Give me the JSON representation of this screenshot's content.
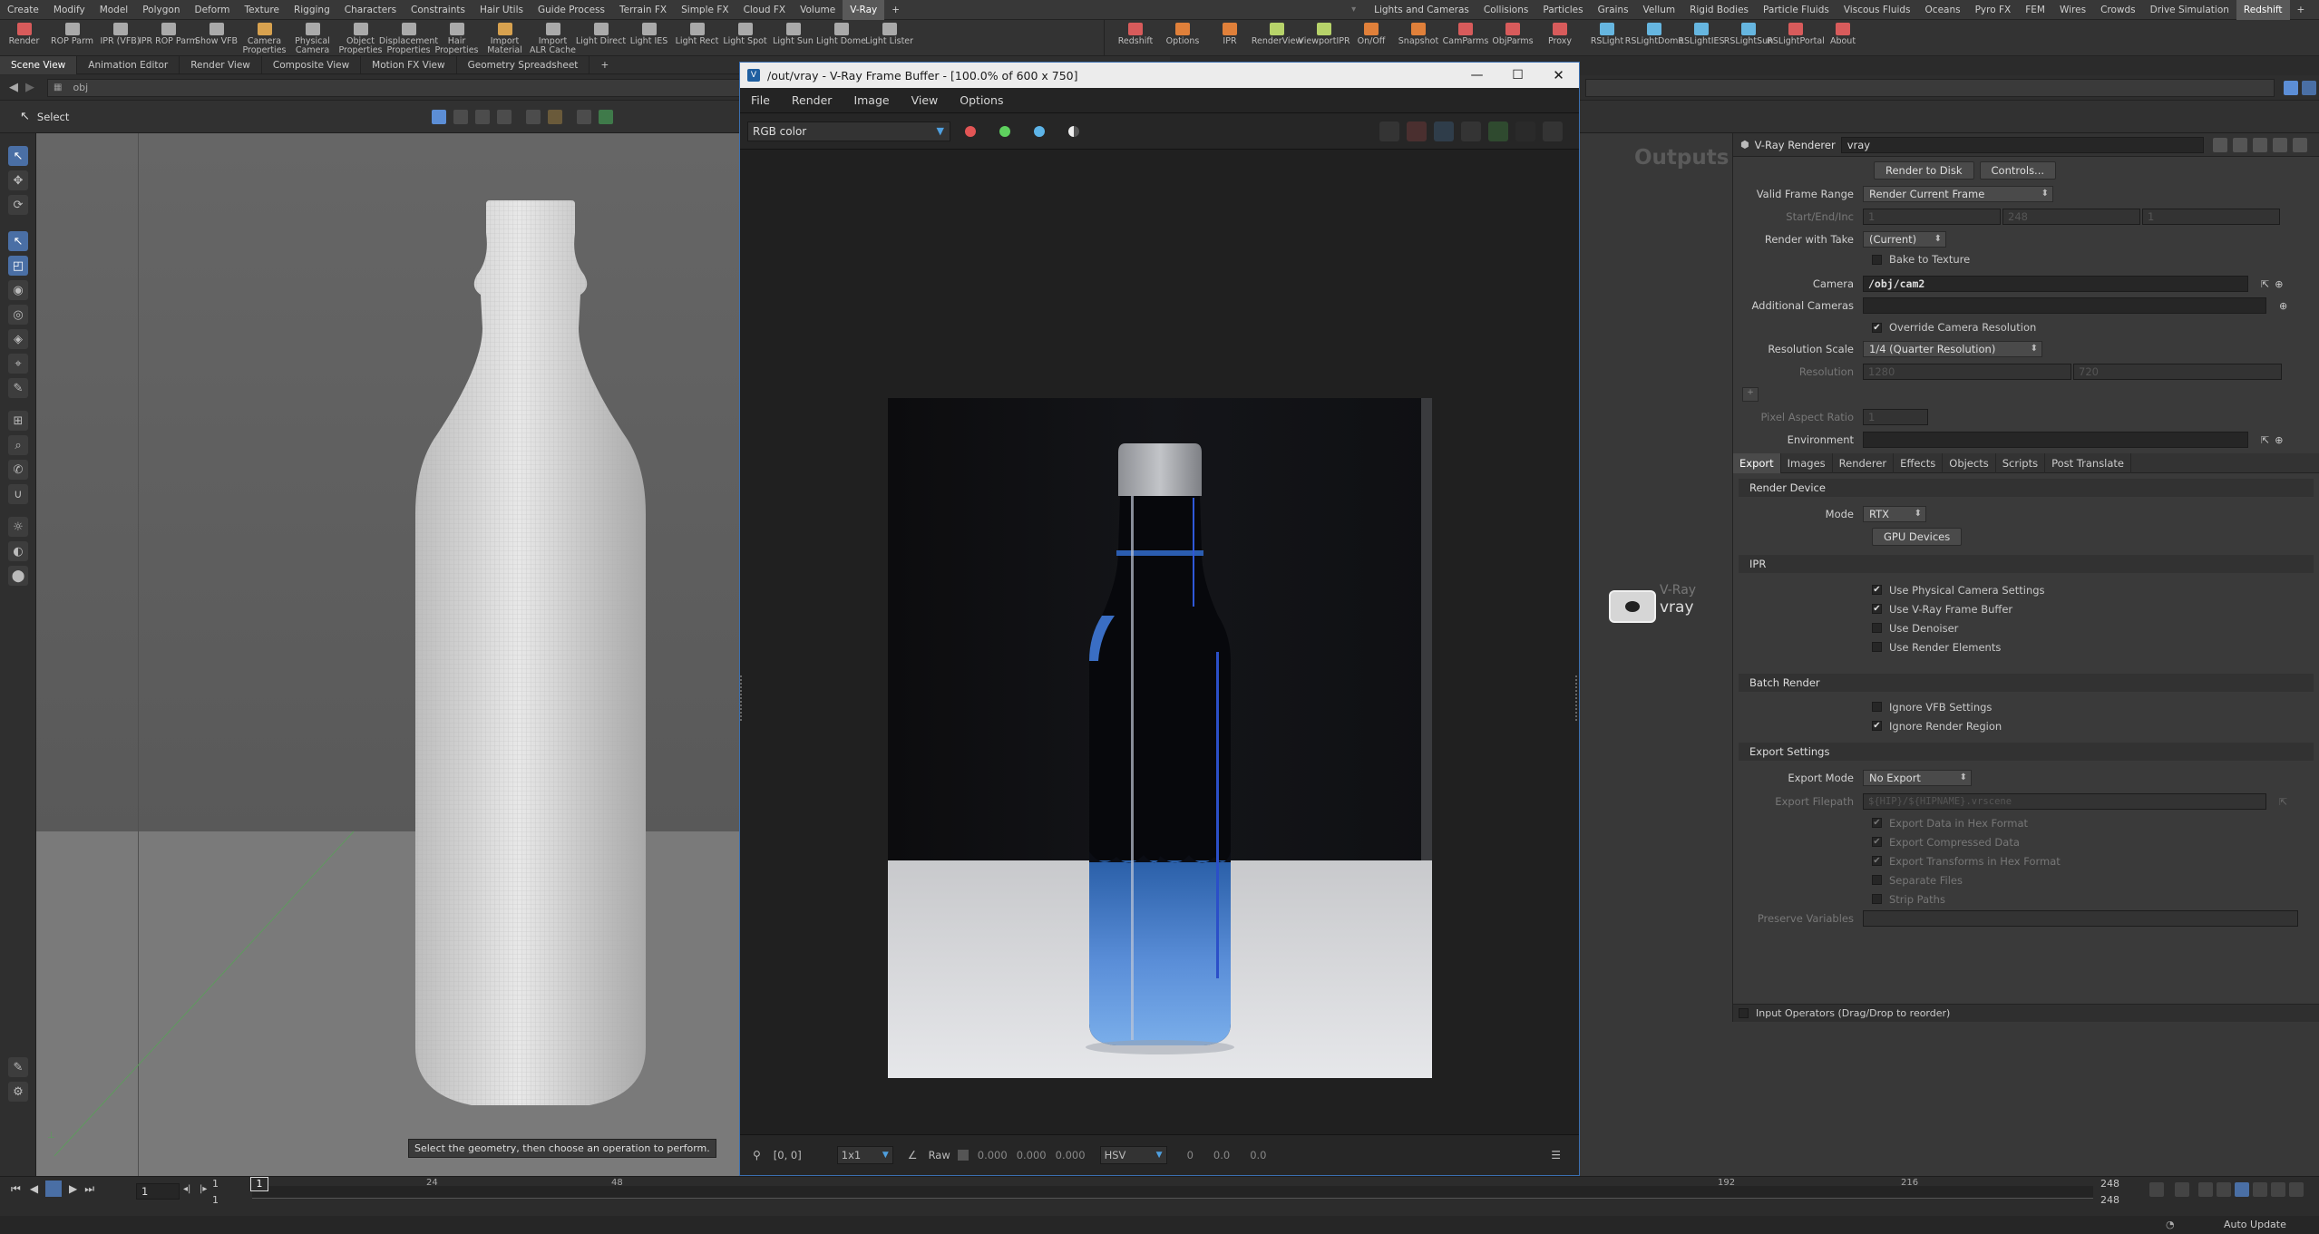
{
  "menubar": {
    "left_items": [
      "Create",
      "Modify",
      "Model",
      "Polygon",
      "Deform",
      "Texture",
      "Rigging",
      "Characters",
      "Constraints",
      "Hair Utils",
      "Guide Process",
      "Terrain FX",
      "Simple FX",
      "Cloud FX",
      "Volume",
      "V-Ray"
    ],
    "right_items": [
      "Lights and Cameras",
      "Collisions",
      "Particles",
      "Grains",
      "Vellum",
      "Rigid Bodies",
      "Particle Fluids",
      "Viscous Fluids",
      "Oceans",
      "Pyro FX",
      "FEM",
      "Wires",
      "Crowds",
      "Drive Simulation",
      "Redshift"
    ],
    "active": "V-Ray",
    "active_right": "Redshift",
    "plus": "+"
  },
  "shelf": {
    "left_tools": [
      {
        "label": "Render",
        "color": "#d85b5b"
      },
      {
        "label": "ROP Parm",
        "color": "#aaaaaa"
      },
      {
        "label": "IPR (VFB)",
        "color": "#aaaaaa"
      },
      {
        "label": "IPR ROP Parm",
        "color": "#aaaaaa"
      },
      {
        "label": "Show VFB",
        "color": "#aaaaaa"
      },
      {
        "label": "Camera\nProperties",
        "color": "#d8a24f"
      },
      {
        "label": "Physical\nCamera",
        "color": "#aaaaaa"
      },
      {
        "label": "Object\nProperties",
        "color": "#aaaaaa"
      },
      {
        "label": "Displacement\nProperties",
        "color": "#aaaaaa"
      },
      {
        "label": "Hair\nProperties",
        "color": "#aaaaaa"
      },
      {
        "label": "Import\nMaterial",
        "color": "#d8a24f"
      },
      {
        "label": "Import\nALR Cache",
        "color": "#aaaaaa"
      },
      {
        "label": "Light Direct",
        "color": "#aaaaaa"
      },
      {
        "label": "Light IES",
        "color": "#aaaaaa"
      },
      {
        "label": "Light Rect",
        "color": "#aaaaaa"
      },
      {
        "label": "Light Spot",
        "color": "#aaaaaa"
      },
      {
        "label": "Light Sun",
        "color": "#aaaaaa"
      },
      {
        "label": "Light Dome",
        "color": "#aaaaaa"
      },
      {
        "label": "Light Lister",
        "color": "#aaaaaa"
      }
    ],
    "right_tools": [
      {
        "label": "Redshift",
        "color": "#d85b5b"
      },
      {
        "label": "Options",
        "color": "#e0803a"
      },
      {
        "label": "IPR",
        "color": "#e0803a"
      },
      {
        "label": "RenderView",
        "color": "#b7d36a"
      },
      {
        "label": "ViewportIPR",
        "color": "#b7d36a"
      },
      {
        "label": "On/Off",
        "color": "#e0803a"
      },
      {
        "label": "Snapshot",
        "color": "#e0803a"
      },
      {
        "label": "CamParms",
        "color": "#d85b5b"
      },
      {
        "label": "ObjParms",
        "color": "#d85b5b"
      },
      {
        "label": "Proxy",
        "color": "#d85b5b"
      },
      {
        "label": "RSLight",
        "color": "#66b6e0"
      },
      {
        "label": "RSLightDome",
        "color": "#66b6e0"
      },
      {
        "label": "RSLightIES",
        "color": "#66b6e0"
      },
      {
        "label": "RSLightSun",
        "color": "#66b6e0"
      },
      {
        "label": "RSLightPortal",
        "color": "#d85b5b"
      },
      {
        "label": "About",
        "color": "#d85b5b"
      }
    ]
  },
  "pane_tabs": [
    "Scene View",
    "Animation Editor",
    "Render View",
    "Composite View",
    "Motion FX View",
    "Geometry Spreadsheet"
  ],
  "pane_tabs_active": "Scene View",
  "path": {
    "value": "obj"
  },
  "state": {
    "label": "Select"
  },
  "viewport": {
    "hint": "Select the geometry, then choose an operation to perform."
  },
  "timeline": {
    "frame": "1",
    "start": "1",
    "start2": "1",
    "end": "248",
    "end2": "248",
    "ticks": [
      "24",
      "48",
      "192",
      "216"
    ],
    "current_marker": "1",
    "auto_update": "Auto Update"
  },
  "vfb": {
    "title": "/out/vray - V-Ray Frame Buffer - [100.0% of 600 x 750]",
    "menu": [
      "File",
      "Render",
      "Image",
      "View",
      "Options"
    ],
    "channel": "RGB color",
    "channel_colors": [
      "#e25555",
      "#5ed15e",
      "#5db4e8"
    ],
    "footer": {
      "coords": "[0, 0]",
      "sample": "1x1",
      "raw": "Raw",
      "rgb": [
        "0.000",
        "0.000",
        "0.000"
      ],
      "mode": "HSV",
      "hsv": [
        "0",
        "0.0",
        "0.0"
      ]
    }
  },
  "network": {
    "outputs": "Outputs",
    "node_label_top": "V-Ray",
    "node_label": "vray"
  },
  "params": {
    "header_type": "V-Ray Renderer",
    "header_name": "vray",
    "render_to_disk": "Render to Disk",
    "controls": "Controls...",
    "valid_frame_range_label": "Valid Frame Range",
    "valid_frame_range": "Render Current Frame",
    "start_end_label": "Start/End/Inc",
    "start_end": [
      "1",
      "248",
      "1"
    ],
    "render_with_take_label": "Render with Take",
    "render_with_take": "(Current)",
    "bake_to_texture": "Bake to Texture",
    "camera_label": "Camera",
    "camera": "/obj/cam2",
    "additional_cameras_label": "Additional Cameras",
    "override_cam_res": "Override Camera Resolution",
    "resolution_scale_label": "Resolution Scale",
    "resolution_scale": "1/4 (Quarter Resolution)",
    "resolution_label": "Resolution",
    "resolution": [
      "1280",
      "720"
    ],
    "pixel_aspect_label": "Pixel Aspect Ratio",
    "pixel_aspect": "1",
    "environment_label": "Environment",
    "tabs": [
      "Export",
      "Images",
      "Renderer",
      "Effects",
      "Objects",
      "Scripts",
      "Post Translate"
    ],
    "tabs_active": "Export",
    "render_device": "Render Device",
    "mode_label": "Mode",
    "mode": "RTX",
    "gpu_devices": "GPU Devices",
    "ipr": "IPR",
    "ipr_items": [
      {
        "label": "Use Physical Camera Settings",
        "checked": "✔"
      },
      {
        "label": "Use V-Ray Frame Buffer",
        "checked": "✔"
      },
      {
        "label": "Use Denoiser",
        "checked": ""
      },
      {
        "label": "Use Render Elements",
        "checked": ""
      }
    ],
    "batch_render": "Batch Render",
    "batch_items": [
      {
        "label": "Ignore VFB Settings",
        "checked": ""
      },
      {
        "label": "Ignore Render Region",
        "checked": "✔"
      }
    ],
    "export_settings": "Export Settings",
    "export_mode_label": "Export Mode",
    "export_mode": "No Export",
    "export_filepath_label": "Export Filepath",
    "export_filepath": "${HIP}/${HIPNAME}.vrscene",
    "export_items": [
      {
        "label": "Export Data in Hex Format",
        "checked": "✔"
      },
      {
        "label": "Export Compressed Data",
        "checked": "✔"
      },
      {
        "label": "Export Transforms in Hex Format",
        "checked": "✔"
      },
      {
        "label": "Separate Files",
        "checked": ""
      },
      {
        "label": "Strip Paths",
        "checked": ""
      }
    ],
    "preserve_variables_label": "Preserve Variables",
    "input_operators": "Input Operators (Drag/Drop to reorder)"
  }
}
